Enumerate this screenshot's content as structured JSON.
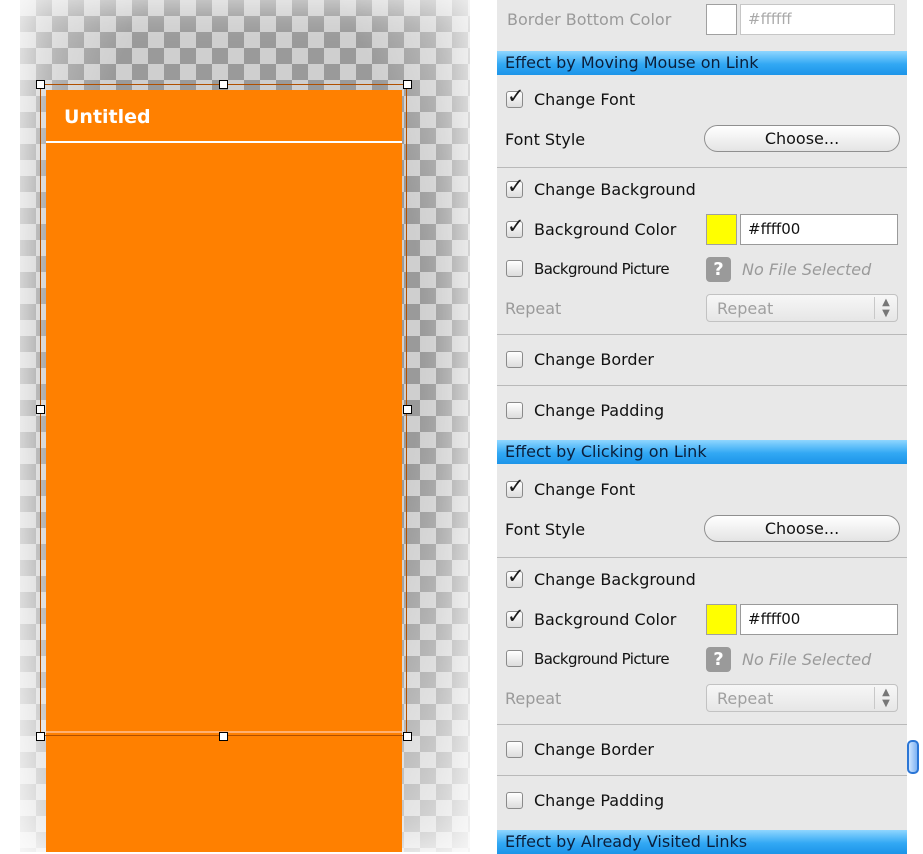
{
  "canvas": {
    "menu_title": "Untitled",
    "menu_color": "#ff8000"
  },
  "inspector": {
    "top": {
      "label": "Border Bottom Color",
      "color_value": "#ffffff",
      "swatch": "#ffffff"
    },
    "sections": [
      {
        "header": "Effect by Moving Mouse on Link",
        "change_font": {
          "label": "Change Font",
          "checked": true
        },
        "font_style": {
          "label": "Font Style",
          "button": "Choose..."
        },
        "change_background": {
          "label": "Change Background",
          "checked": true
        },
        "background_color": {
          "label": "Background Color",
          "checked": true,
          "value": "#ffff00",
          "swatch": "#ffff00"
        },
        "background_picture": {
          "label": "Background Picture",
          "checked": false,
          "file": "No File Selected"
        },
        "repeat": {
          "label": "Repeat",
          "selected": "Repeat"
        },
        "change_border": {
          "label": "Change Border",
          "checked": false
        },
        "change_padding": {
          "label": "Change Padding",
          "checked": false
        }
      },
      {
        "header": "Effect by Clicking on Link",
        "change_font": {
          "label": "Change Font",
          "checked": true
        },
        "font_style": {
          "label": "Font Style",
          "button": "Choose..."
        },
        "change_background": {
          "label": "Change Background",
          "checked": true
        },
        "background_color": {
          "label": "Background Color",
          "checked": true,
          "value": "#ffff00",
          "swatch": "#ffff00"
        },
        "background_picture": {
          "label": "Background Picture",
          "checked": false,
          "file": "No File Selected"
        },
        "repeat": {
          "label": "Repeat",
          "selected": "Repeat"
        },
        "change_border": {
          "label": "Change Border",
          "checked": false
        },
        "change_padding": {
          "label": "Change Padding",
          "checked": false
        }
      }
    ],
    "next_header": "Effect by Already Visited Links",
    "header_color": "#32a8f4"
  }
}
